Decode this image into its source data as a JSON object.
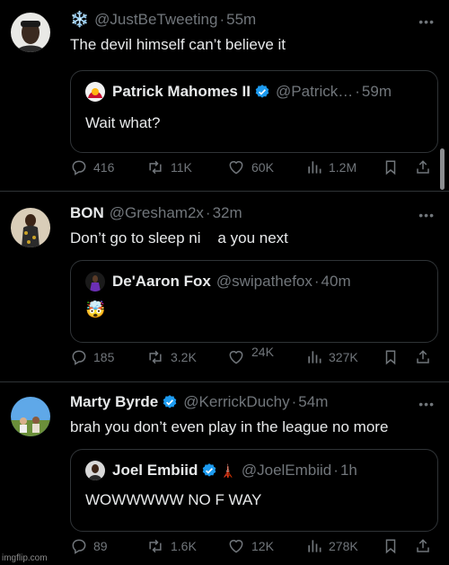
{
  "tweets": [
    {
      "emoji": "❄️",
      "handle": "@JustBeTweeting",
      "sep": "·",
      "time": "55m",
      "text": "The devil himself can’t believe it",
      "more": "•••",
      "quote": {
        "name": "Patrick Mahomes II",
        "handle": "@Patrick…",
        "sep": "·",
        "time": "59m",
        "text": "Wait what?"
      },
      "actions": {
        "replies": "416",
        "reposts": "11K",
        "likes": "60K",
        "views": "1.2M"
      }
    },
    {
      "name": "BON",
      "handle": "@Gresham2x",
      "sep": "·",
      "time": "32m",
      "text": "Don’t go to sleep ni    a you next",
      "more": "•••",
      "quote": {
        "name": "De'Aaron Fox",
        "handle": "@swipathefox",
        "sep": "·",
        "time": "40m",
        "text": "🤯"
      },
      "actions": {
        "replies": "185",
        "reposts": "3.2K",
        "likes": "24K",
        "views": "327K"
      }
    },
    {
      "name": "Marty Byrde",
      "handle": "@KerrickDuchy",
      "sep": "·",
      "time": "54m",
      "text": "brah you don’t even play in the league no more",
      "more": "•••",
      "quote": {
        "name": "Joel Embiid",
        "badge": "🗼",
        "handle": "@JoelEmbiid",
        "sep": "·",
        "time": "1h",
        "text": "WOWWWWW NO F WAY"
      },
      "actions": {
        "replies": "89",
        "reposts": "1.6K",
        "likes": "12K",
        "views": "278K"
      }
    }
  ],
  "watermark": "imgflip.com",
  "colors": {
    "verified": "#1d9bf0",
    "muted": "#71767b",
    "text": "#e7e9ea",
    "border": "#2f3336"
  }
}
